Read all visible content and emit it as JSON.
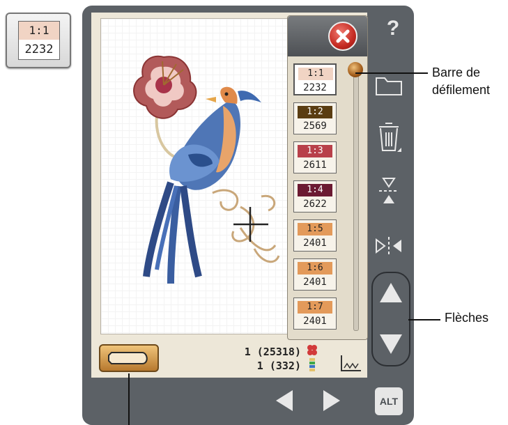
{
  "standalone_chip": {
    "code": "1:1",
    "number": "2232"
  },
  "colors": [
    {
      "code": "1:1",
      "number": "2232",
      "color": "#f1d4c4",
      "text": "#222222",
      "selected": true
    },
    {
      "code": "1:2",
      "number": "2569",
      "color": "#5a3d12",
      "text": "#ffffff",
      "selected": false
    },
    {
      "code": "1:3",
      "number": "2611",
      "color": "#b8404a",
      "text": "#ffffff",
      "selected": false
    },
    {
      "code": "1:4",
      "number": "2622",
      "color": "#6b1a32",
      "text": "#ffffff",
      "selected": false
    },
    {
      "code": "1:5",
      "number": "2401",
      "color": "#e39a5a",
      "text": "#222222",
      "selected": false
    },
    {
      "code": "1:6",
      "number": "2401",
      "color": "#e39a5a",
      "text": "#222222",
      "selected": false
    },
    {
      "code": "1:7",
      "number": "2401",
      "color": "#e39a5a",
      "text": "#222222",
      "selected": false
    }
  ],
  "status": {
    "stitches": "1 (25318)",
    "colors": "1 (332)"
  },
  "buttons": {
    "help": "?",
    "alt": "ALT"
  },
  "callouts": {
    "scrollbar": "Barre de\ndéfilement",
    "arrows": "Flèches"
  },
  "theme": {
    "device": "#5c6166",
    "screen": "#ede7d8",
    "close": "#c42a22",
    "back_button": "#d9a35a"
  }
}
